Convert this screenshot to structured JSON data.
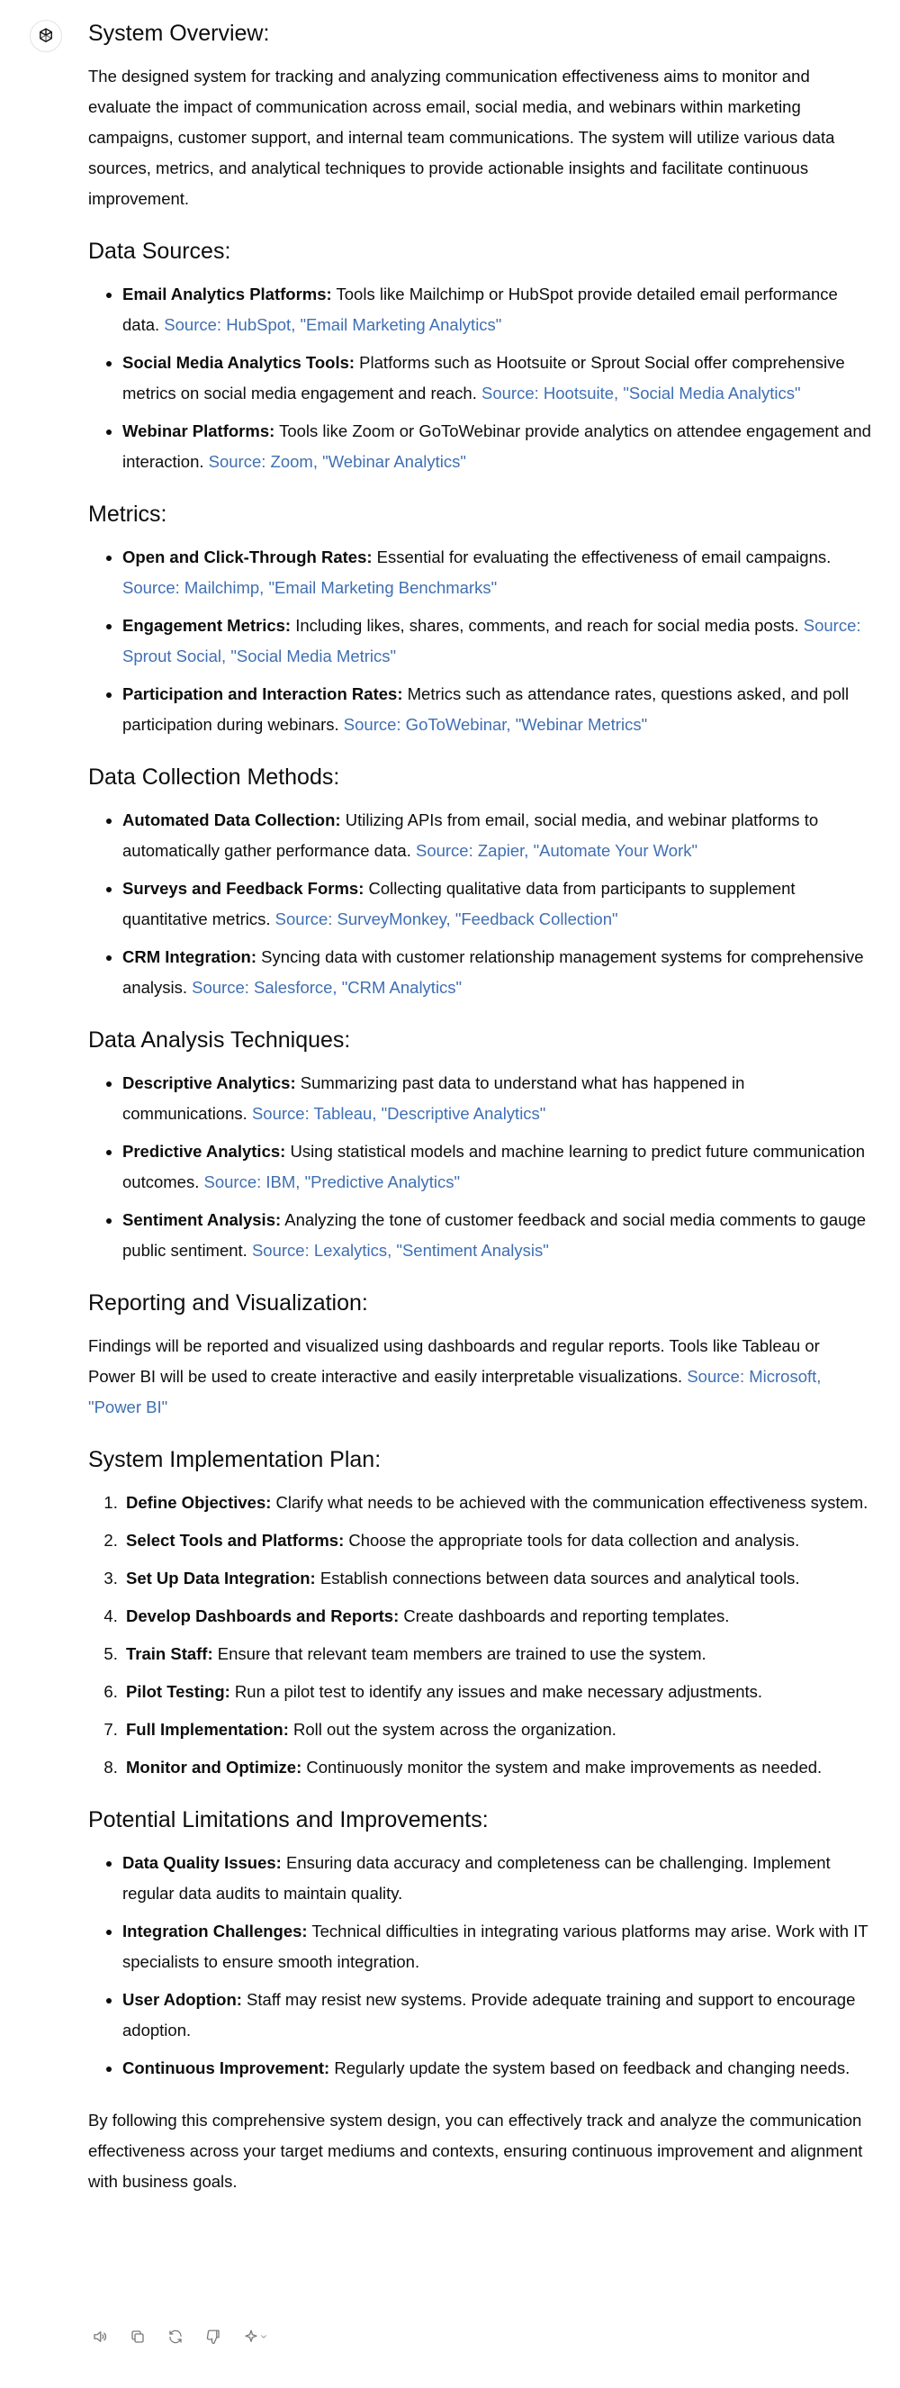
{
  "overview": {
    "title": "System Overview:",
    "text": "The designed system for tracking and analyzing communication effectiveness aims to monitor and evaluate the impact of communication across email, social media, and webinars within marketing campaigns, customer support, and internal team communications. The system will utilize various data sources, metrics, and analytical techniques to provide actionable insights and facilitate continuous improvement."
  },
  "data_sources": {
    "title": "Data Sources:",
    "items": [
      {
        "term": "Email Analytics Platforms:",
        "desc": " Tools like Mailchimp or HubSpot provide detailed email performance data. ",
        "source": "Source: HubSpot, \"Email Marketing Analytics\""
      },
      {
        "term": "Social Media Analytics Tools:",
        "desc": " Platforms such as Hootsuite or Sprout Social offer comprehensive metrics on social media engagement and reach. ",
        "source": "Source: Hootsuite, \"Social Media Analytics\""
      },
      {
        "term": "Webinar Platforms:",
        "desc": " Tools like Zoom or GoToWebinar provide analytics on attendee engagement and interaction. ",
        "source": "Source: Zoom, \"Webinar Analytics\""
      }
    ]
  },
  "metrics": {
    "title": "Metrics:",
    "items": [
      {
        "term": "Open and Click-Through Rates:",
        "desc": " Essential for evaluating the effectiveness of email campaigns. ",
        "source": "Source: Mailchimp, \"Email Marketing Benchmarks\""
      },
      {
        "term": "Engagement Metrics:",
        "desc": " Including likes, shares, comments, and reach for social media posts. ",
        "source": "Source: Sprout Social, \"Social Media Metrics\""
      },
      {
        "term": "Participation and Interaction Rates:",
        "desc": " Metrics such as attendance rates, questions asked, and poll participation during webinars. ",
        "source": "Source: GoToWebinar, \"Webinar Metrics\""
      }
    ]
  },
  "collection": {
    "title": "Data Collection Methods:",
    "items": [
      {
        "term": "Automated Data Collection:",
        "desc": " Utilizing APIs from email, social media, and webinar platforms to automatically gather performance data. ",
        "source": "Source: Zapier, \"Automate Your Work\""
      },
      {
        "term": "Surveys and Feedback Forms:",
        "desc": " Collecting qualitative data from participants to supplement quantitative metrics. ",
        "source": "Source: SurveyMonkey, \"Feedback Collection\""
      },
      {
        "term": "CRM Integration:",
        "desc": " Syncing data with customer relationship management systems for comprehensive analysis. ",
        "source": "Source: Salesforce, \"CRM Analytics\""
      }
    ]
  },
  "analysis": {
    "title": "Data Analysis Techniques:",
    "items": [
      {
        "term": "Descriptive Analytics:",
        "desc": " Summarizing past data to understand what has happened in communications. ",
        "source": "Source: Tableau, \"Descriptive Analytics\""
      },
      {
        "term": "Predictive Analytics:",
        "desc": " Using statistical models and machine learning to predict future communication outcomes. ",
        "source": "Source: IBM, \"Predictive Analytics\""
      },
      {
        "term": "Sentiment Analysis:",
        "desc": " Analyzing the tone of customer feedback and social media comments to gauge public sentiment. ",
        "source": "Source: Lexalytics, \"Sentiment Analysis\""
      }
    ]
  },
  "reporting": {
    "title": "Reporting and Visualization:",
    "text": "Findings will be reported and visualized using dashboards and regular reports. Tools like Tableau or Power BI will be used to create interactive and easily interpretable visualizations. ",
    "source": "Source: Microsoft, \"Power BI\""
  },
  "implementation": {
    "title": "System Implementation Plan:",
    "items": [
      {
        "term": "Define Objectives:",
        "desc": " Clarify what needs to be achieved with the communication effectiveness system."
      },
      {
        "term": "Select Tools and Platforms:",
        "desc": " Choose the appropriate tools for data collection and analysis."
      },
      {
        "term": "Set Up Data Integration:",
        "desc": " Establish connections between data sources and analytical tools."
      },
      {
        "term": "Develop Dashboards and Reports:",
        "desc": " Create dashboards and reporting templates."
      },
      {
        "term": "Train Staff:",
        "desc": " Ensure that relevant team members are trained to use the system."
      },
      {
        "term": "Pilot Testing:",
        "desc": " Run a pilot test to identify any issues and make necessary adjustments."
      },
      {
        "term": "Full Implementation:",
        "desc": " Roll out the system across the organization."
      },
      {
        "term": "Monitor and Optimize:",
        "desc": " Continuously monitor the system and make improvements as needed."
      }
    ]
  },
  "limitations": {
    "title": "Potential Limitations and Improvements:",
    "items": [
      {
        "term": "Data Quality Issues:",
        "desc": " Ensuring data accuracy and completeness can be challenging. Implement regular data audits to maintain quality."
      },
      {
        "term": "Integration Challenges:",
        "desc": " Technical difficulties in integrating various platforms may arise. Work with IT specialists to ensure smooth integration."
      },
      {
        "term": "User Adoption:",
        "desc": " Staff may resist new systems. Provide adequate training and support to encourage adoption."
      },
      {
        "term": "Continuous Improvement:",
        "desc": " Regularly update the system based on feedback and changing needs."
      }
    ]
  },
  "closing": "By following this comprehensive system design, you can effectively track and analyze the communication effectiveness across your target mediums and contexts, ensuring continuous improvement and alignment with business goals.",
  "actions": [
    "speaker-icon",
    "copy-icon",
    "regenerate-icon",
    "thumbs-down-icon",
    "sparkle-icon"
  ],
  "colors": {
    "link": "#3f6fb3",
    "text": "#0d0d0d",
    "icon": "#7a7a7a"
  }
}
